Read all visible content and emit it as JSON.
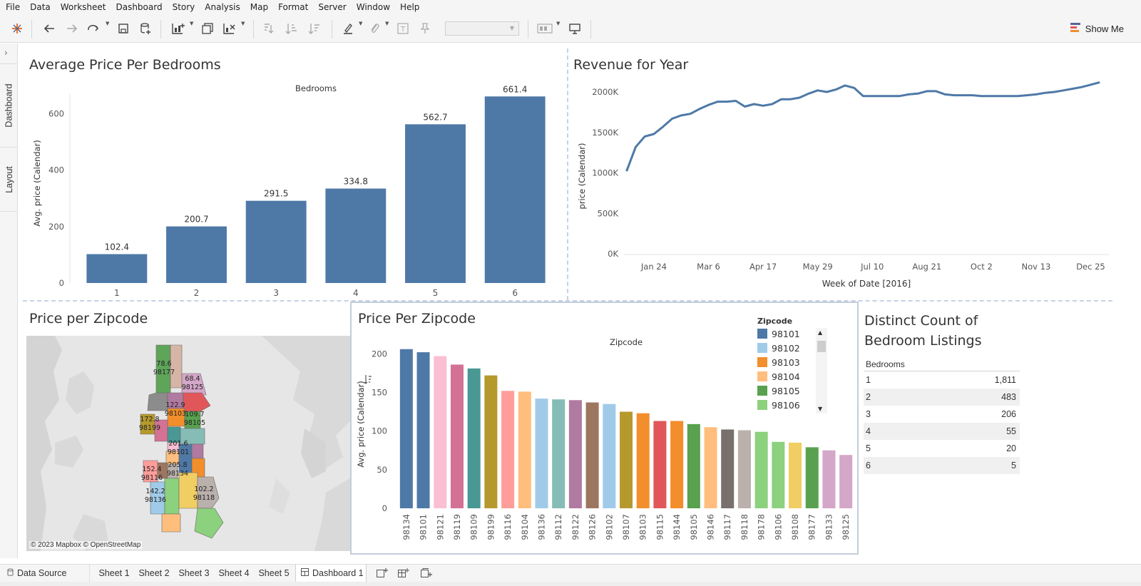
{
  "menu": [
    "File",
    "Data",
    "Worksheet",
    "Dashboard",
    "Story",
    "Analysis",
    "Map",
    "Format",
    "Server",
    "Window",
    "Help"
  ],
  "toolbar": {
    "icons": [
      "tableau-logo-icon",
      "undo-icon",
      "redo-icon",
      "replay-icon",
      "save-icon",
      "new-datasource-icon",
      "new-worksheet-icon",
      "duplicate-sheet-icon",
      "clear-sheet-icon",
      "swap-icon",
      "sort-ascending-icon",
      "sort-descending-icon",
      "highlight-icon",
      "group-icon",
      "label-icon",
      "pin-icon",
      "show-cards-icon",
      "presentation-icon"
    ],
    "fit_value": "",
    "show_me_label": "Show Me"
  },
  "side_tabs": [
    "Dashboard",
    "Layout"
  ],
  "colors": {
    "bar_blue": "#4e79a7",
    "accent_line": "#4e79a7",
    "dash": "#c5d3e3"
  },
  "panels": {
    "avg_price_bedrooms": {
      "title": "Average Price Per Bedrooms"
    },
    "revenue_year": {
      "title": "Revenue for Year"
    },
    "map": {
      "title": "Price per Zipcode",
      "attribution": "© 2023 Mapbox © OpenStreetMap"
    },
    "price_zip": {
      "title": "Price Per Zipcode"
    },
    "distinct": {
      "title_line1": "Distinct Count of",
      "title_line2": "Bedroom Listings"
    }
  },
  "map_labels": [
    {
      "price": "78.6",
      "zip": "98177"
    },
    {
      "price": "68.4",
      "zip": "98125"
    },
    {
      "price": "122.9",
      "zip": "98103"
    },
    {
      "price": "109.7",
      "zip": "98105"
    },
    {
      "price": "172.8",
      "zip": "98199"
    },
    {
      "price": "201.6",
      "zip": "98101"
    },
    {
      "price": "152.4",
      "zip": "98116"
    },
    {
      "price": "205.8",
      "zip": "98134"
    },
    {
      "price": "142.2",
      "zip": "98136"
    },
    {
      "price": "102.2",
      "zip": "98118"
    }
  ],
  "legend": {
    "title": "Zipcode",
    "items": [
      {
        "label": "98101",
        "color": "#4e79a7"
      },
      {
        "label": "98102",
        "color": "#a0cbe8"
      },
      {
        "label": "98103",
        "color": "#f28e2b"
      },
      {
        "label": "98104",
        "color": "#ffbe7d"
      },
      {
        "label": "98105",
        "color": "#59a14f"
      },
      {
        "label": "98106",
        "color": "#8cd17d"
      }
    ]
  },
  "distinct_table": {
    "header": "Bedrooms",
    "rows": [
      {
        "bedrooms": "1",
        "count": "1,811"
      },
      {
        "bedrooms": "2",
        "count": "483"
      },
      {
        "bedrooms": "3",
        "count": "206"
      },
      {
        "bedrooms": "4",
        "count": "55"
      },
      {
        "bedrooms": "5",
        "count": "20"
      },
      {
        "bedrooms": "6",
        "count": "5"
      }
    ]
  },
  "sheet_tabs": [
    "Data Source",
    "Sheet 1",
    "Sheet 2",
    "Sheet 3",
    "Sheet 4",
    "Sheet 5",
    "Dashboard 1"
  ],
  "active_tab": "Dashboard 1",
  "chart_data": [
    {
      "type": "bar",
      "title": "Average Price Per Bedrooms",
      "header": "Bedrooms",
      "xlabel": "",
      "ylabel": "Avg. price (Calendar)",
      "categories": [
        "1",
        "2",
        "3",
        "4",
        "5",
        "6"
      ],
      "values": [
        102.4,
        200.7,
        291.5,
        334.8,
        562.7,
        661.4
      ],
      "value_labels": [
        "102.4",
        "200.7",
        "291.5",
        "334.8",
        "562.7",
        "661.4"
      ],
      "yticks": [
        "0",
        "200",
        "400",
        "600"
      ],
      "ylim": [
        0,
        700
      ],
      "grid": false,
      "color": "#4e79a7"
    },
    {
      "type": "line",
      "title": "Revenue for Year",
      "xlabel": "Week of Date [2016]",
      "ylabel": "price (Calendar)",
      "xticks": [
        "Jan 24",
        "Mar 6",
        "Apr 17",
        "May 29",
        "Jul 10",
        "Aug 21",
        "Oct 2",
        "Nov 13",
        "Dec 25"
      ],
      "yticks": [
        "0K",
        "500K",
        "1000K",
        "1500K",
        "2000K"
      ],
      "ylim": [
        0,
        2150000
      ],
      "x_dates": [
        "2016-01-03",
        "2016-01-10",
        "2016-01-17",
        "2016-01-24",
        "2016-01-31",
        "2016-02-07",
        "2016-02-14",
        "2016-02-21",
        "2016-02-28",
        "2016-03-06",
        "2016-03-13",
        "2016-03-20",
        "2016-03-27",
        "2016-04-03",
        "2016-04-10",
        "2016-04-17",
        "2016-04-24",
        "2016-05-01",
        "2016-05-08",
        "2016-05-15",
        "2016-05-22",
        "2016-05-29",
        "2016-06-05",
        "2016-06-12",
        "2016-06-19",
        "2016-06-26",
        "2016-07-03",
        "2016-07-10",
        "2016-07-17",
        "2016-07-24",
        "2016-07-31",
        "2016-08-07",
        "2016-08-14",
        "2016-08-21",
        "2016-08-28",
        "2016-09-04",
        "2016-09-11",
        "2016-09-18",
        "2016-09-25",
        "2016-10-02",
        "2016-10-09",
        "2016-10-16",
        "2016-10-23",
        "2016-10-30",
        "2016-11-06",
        "2016-11-13",
        "2016-11-20",
        "2016-11-27",
        "2016-12-04",
        "2016-12-11",
        "2016-12-18",
        "2016-12-25",
        "2017-01-01"
      ],
      "values": [
        1020000,
        1320000,
        1450000,
        1480000,
        1570000,
        1670000,
        1710000,
        1730000,
        1790000,
        1840000,
        1880000,
        1880000,
        1890000,
        1820000,
        1850000,
        1830000,
        1850000,
        1910000,
        1910000,
        1930000,
        1980000,
        2020000,
        2000000,
        2030000,
        2080000,
        2050000,
        1950000,
        1950000,
        1950000,
        1950000,
        1950000,
        1970000,
        1980000,
        2010000,
        2010000,
        1970000,
        1960000,
        1960000,
        1960000,
        1950000,
        1950000,
        1950000,
        1950000,
        1950000,
        1960000,
        1970000,
        1990000,
        2000000,
        2020000,
        2040000,
        2060000,
        2090000,
        2120000
      ],
      "grid": false,
      "color": "#4e79a7"
    },
    {
      "type": "bar",
      "title": "Price Per Zipcode",
      "header": "Zipcode",
      "ylabel": "Avg. price (Calendar)",
      "categories": [
        "98134",
        "98101",
        "98121",
        "98119",
        "98109",
        "98199",
        "98116",
        "98104",
        "98136",
        "98112",
        "98122",
        "98126",
        "98102",
        "98107",
        "98103",
        "98115",
        "98144",
        "98105",
        "98146",
        "98117",
        "98118",
        "98178",
        "98106",
        "98108",
        "98177",
        "98133",
        "98125"
      ],
      "values": [
        206,
        202,
        197,
        186,
        181,
        172,
        152,
        151,
        142,
        141,
        140,
        137,
        135,
        125,
        123,
        113,
        113,
        109,
        105,
        102,
        101,
        99,
        86,
        85,
        79,
        75,
        69
      ],
      "colors": [
        "#4e79a7",
        "#4e79a7",
        "#fabfd2",
        "#d37295",
        "#499894",
        "#b6992d",
        "#ff9d9a",
        "#ffbe7d",
        "#a0cbe8",
        "#86bcb6",
        "#b07aa1",
        "#9d7660",
        "#a0cbe8",
        "#b6992d",
        "#f28e2b",
        "#e15759",
        "#f28e2b",
        "#59a14f",
        "#ffbe7d",
        "#79706e",
        "#bab0ac",
        "#8cd17d",
        "#8cd17d",
        "#f1ce63",
        "#59a14f",
        "#d4a6c8",
        "#d4a6c8"
      ],
      "yticks": [
        "0",
        "50",
        "100",
        "150",
        "200"
      ],
      "ylim": [
        0,
        215
      ],
      "grid": false
    }
  ]
}
